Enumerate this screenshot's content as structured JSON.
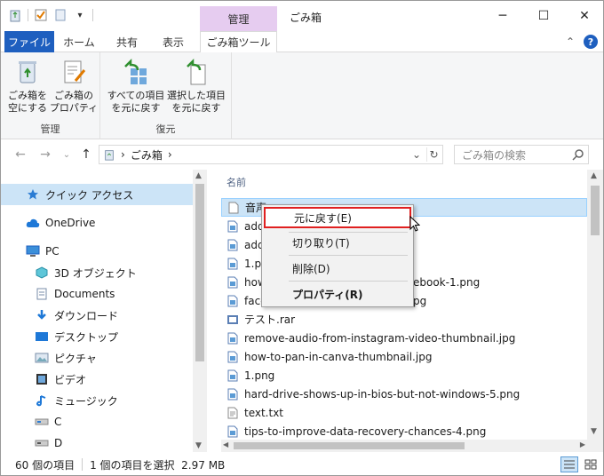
{
  "titlebar": {
    "context_tab": "管理",
    "title": "ごみ箱",
    "minimize": "─",
    "maximize": "☐",
    "close": "✕"
  },
  "ribbon_tabs": {
    "file": "ファイル",
    "home": "ホーム",
    "share": "共有",
    "view": "表示",
    "recycle_tools": "ごみ箱ツール",
    "collapse": "⌃",
    "help": "?"
  },
  "ribbon": {
    "manage_group": {
      "label": "管理",
      "empty_line1": "ごみ箱を",
      "empty_line2": "空にする",
      "props_line1": "ごみ箱の",
      "props_line2": "プロパティ"
    },
    "restore_group": {
      "label": "復元",
      "all_line1": "すべての項目",
      "all_line2": "を元に戻す",
      "sel_line1": "選択した項目",
      "sel_line2": "を元に戻す"
    }
  },
  "address": {
    "path_sep1": "›",
    "path": "ごみ箱",
    "path_sep2": "›",
    "dropdown": "⌄",
    "refresh": "↻",
    "search_placeholder": "ごみ箱の検索"
  },
  "navpane": {
    "items": [
      {
        "label": "クイック アクセス",
        "icon": "star-icon"
      },
      {
        "label": "OneDrive",
        "icon": "cloud-icon"
      },
      {
        "label": "PC",
        "icon": "pc-icon"
      },
      {
        "label": "3D オブジェクト",
        "icon": "cube-icon"
      },
      {
        "label": "Documents",
        "icon": "document-icon"
      },
      {
        "label": "ダウンロード",
        "icon": "download-icon"
      },
      {
        "label": "デスクトップ",
        "icon": "desktop-icon"
      },
      {
        "label": "ピクチャ",
        "icon": "pictures-icon"
      },
      {
        "label": "ビデオ",
        "icon": "video-icon"
      },
      {
        "label": "ミュージック",
        "icon": "music-icon"
      },
      {
        "label": "C",
        "icon": "drive-icon"
      },
      {
        "label": "D",
        "icon": "drive-icon"
      }
    ]
  },
  "filelist": {
    "column_name": "名前",
    "files": [
      {
        "name": "音声",
        "icon": "blank-file-icon"
      },
      {
        "name": "add",
        "icon": "image-file-icon"
      },
      {
        "name": "add",
        "icon": "image-file-icon"
      },
      {
        "name": "1.pn",
        "icon": "image-file-icon"
      },
      {
        "name": "how",
        "icon": "image-file-icon"
      },
      {
        "name": "face",
        "icon": "image-file-icon"
      },
      {
        "name": "テスト.rar",
        "icon": "archive-file-icon"
      },
      {
        "name": "remove-audio-from-instagram-video-thumbnail.jpg",
        "icon": "image-file-icon"
      },
      {
        "name": "how-to-pan-in-canva-thumbnail.jpg",
        "icon": "image-file-icon"
      },
      {
        "name": "1.png",
        "icon": "image-file-icon"
      },
      {
        "name": "hard-drive-shows-up-in-bios-but-not-windows-5.png",
        "icon": "image-file-icon"
      },
      {
        "name": "text.txt",
        "icon": "text-file-icon"
      },
      {
        "name": "tips-to-improve-data-recovery-chances-4.png",
        "icon": "image-file-icon"
      }
    ],
    "tail_row5": "ebook-1.png",
    "tail_row6": "pg"
  },
  "context_menu": {
    "restore": "元に戻す(E)",
    "cut": "切り取り(T)",
    "delete": "削除(D)",
    "properties": "プロパティ(R)"
  },
  "statusbar": {
    "item_count": "60 個の項目",
    "selection": "1 個の項目を選択  2.97 MB"
  },
  "colors": {
    "accent": "#1e5fbf",
    "selection": "#cce4f7",
    "context_tab": "#e6ccf0",
    "highlight_border": "#e02020"
  }
}
